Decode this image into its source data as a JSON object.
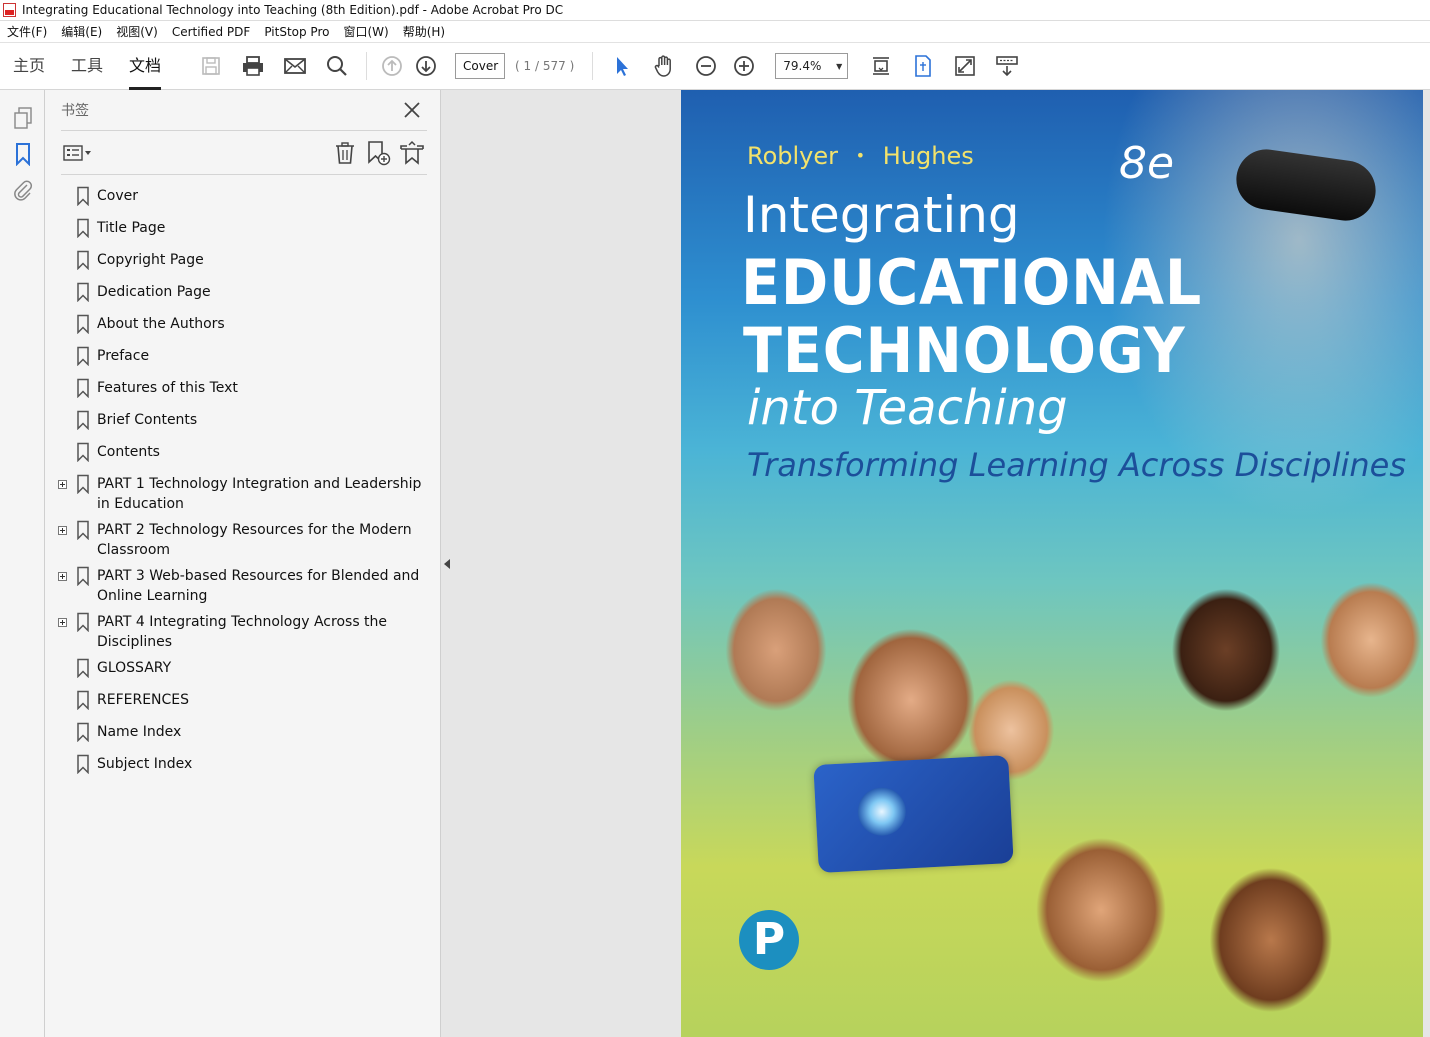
{
  "window": {
    "title": "Integrating Educational Technology into Teaching (8th Edition).pdf - Adobe Acrobat Pro DC"
  },
  "menubar": {
    "items": [
      "文件(F)",
      "编辑(E)",
      "视图(V)",
      "Certified PDF",
      "PitStop Pro",
      "窗口(W)",
      "帮助(H)"
    ]
  },
  "toolbar": {
    "tabs": [
      "主页",
      "工具",
      "文档"
    ],
    "active_tab": "文档",
    "page_field": "Cover",
    "page_count": "( 1 / 577 )",
    "zoom": "79.4%"
  },
  "bookmarks_panel": {
    "title": "书签",
    "items": [
      {
        "label": "Cover",
        "expandable": false
      },
      {
        "label": "Title Page",
        "expandable": false
      },
      {
        "label": "Copyright Page",
        "expandable": false
      },
      {
        "label": "Dedication Page",
        "expandable": false
      },
      {
        "label": "About the Authors",
        "expandable": false
      },
      {
        "label": "Preface",
        "expandable": false
      },
      {
        "label": "Features of this Text",
        "expandable": false
      },
      {
        "label": "Brief Contents",
        "expandable": false
      },
      {
        "label": "Contents",
        "expandable": false
      },
      {
        "label": "PART 1 Technology Integration and Leadership in Education",
        "expandable": true
      },
      {
        "label": "PART 2 Technology Resources for the Modern Classroom",
        "expandable": true
      },
      {
        "label": "PART 3 Web-based Resources for Blended and Online Learning",
        "expandable": true
      },
      {
        "label": "PART 4 Integrating Technology Across the Disciplines",
        "expandable": true
      },
      {
        "label": "GLOSSARY",
        "expandable": false
      },
      {
        "label": "REFERENCES",
        "expandable": false
      },
      {
        "label": "Name Index",
        "expandable": false
      },
      {
        "label": "Subject Index",
        "expandable": false
      }
    ]
  },
  "cover": {
    "author1": "Roblyer",
    "separator": "•",
    "author2": "Hughes",
    "edition": "8e",
    "title_line1": "Integrating",
    "title_line2": "EDUCATIONAL",
    "title_line3": "TECHNOLOGY",
    "title_line4": "into Teaching",
    "subtitle": "Transforming Learning Across Disciplines",
    "publisher_logo": "P"
  },
  "colors": {
    "accent_blue": "#2c72d8",
    "cover_author_yellow": "#f3e26b",
    "cover_subtitle_blue": "#1c4f9a"
  }
}
